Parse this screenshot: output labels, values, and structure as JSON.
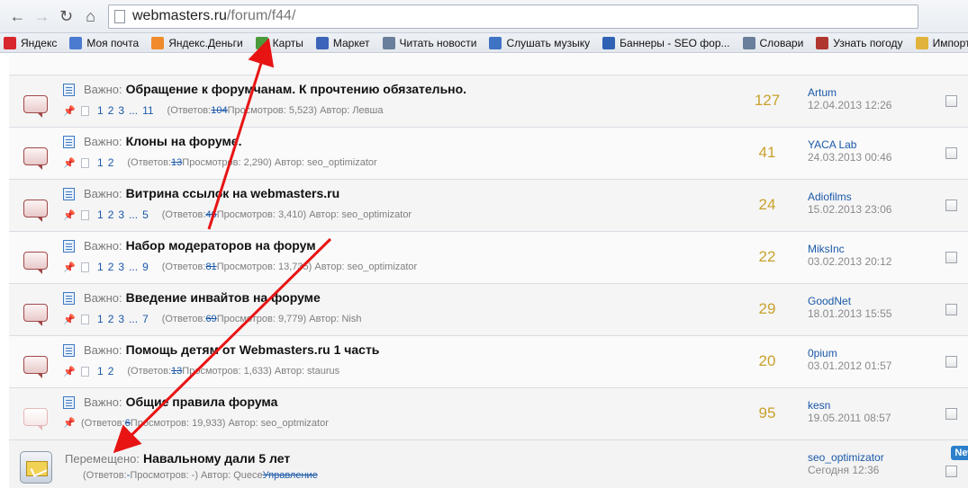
{
  "browser": {
    "url_host": "webmasters.ru",
    "url_path": "/forum/f44/"
  },
  "bookmarks": [
    {
      "label": "Яндекс",
      "icon": "yandex-icon",
      "color": "#d8272d"
    },
    {
      "label": "Моя почта",
      "icon": "mail-icon",
      "color": "#4a7bd0"
    },
    {
      "label": "Яндекс.Деньги",
      "icon": "money-icon",
      "color": "#f08b2b"
    },
    {
      "label": "Карты",
      "icon": "map-icon",
      "color": "#4a9a3c"
    },
    {
      "label": "Маркет",
      "icon": "market-icon",
      "color": "#3c64b8"
    },
    {
      "label": "Читать новости",
      "icon": "page-icon",
      "color": "#6a7f9b"
    },
    {
      "label": "Слушать музыку",
      "icon": "music-icon",
      "color": "#3f73c4"
    },
    {
      "label": "Баннеры - SEO фор...",
      "icon": "star-icon",
      "color": "#2f62b4"
    },
    {
      "label": "Словари",
      "icon": "page-icon",
      "color": "#6a7f9b"
    },
    {
      "label": "Узнать погоду",
      "icon": "weather-icon",
      "color": "#b0372f"
    },
    {
      "label": "Импорт",
      "icon": "folder-icon",
      "color": "#e0b43c"
    }
  ],
  "topics": [
    {
      "prefix": "Важно:",
      "title": "Обращение к форумчанам. К прочтению обязательно.",
      "pages": [
        "1",
        "2",
        "3",
        "...",
        "11"
      ],
      "meta_before": "(Ответов: ",
      "replies_struck": "104",
      "meta_after": " Просмотров: 5,523) Автор: Левша",
      "replies": "127",
      "last_user": "Artum",
      "last_time": "12.04.2013 12:26"
    },
    {
      "prefix": "Важно:",
      "title": "Клоны на форуме.",
      "pages": [
        "1",
        "2"
      ],
      "meta_before": "(Ответов: ",
      "replies_struck": "13",
      "meta_after": " Просмотров: 2,290) Автор: seo_optimizator",
      "replies": "41",
      "last_user": "YACA Lab",
      "last_time": "24.03.2013 00:46"
    },
    {
      "prefix": "Важно:",
      "title": "Витрина ссылок на webmasters.ru",
      "pages": [
        "1",
        "2",
        "3",
        "...",
        "5"
      ],
      "meta_before": "(Ответов: ",
      "replies_struck": "46",
      "meta_after": " Просмотров: 3,410) Автор: seo_optimizator",
      "replies": "24",
      "last_user": "Adiofilms",
      "last_time": "15.02.2013 23:06"
    },
    {
      "prefix": "Важно:",
      "title": "Набор модераторов на форум",
      "pages": [
        "1",
        "2",
        "3",
        "...",
        "9"
      ],
      "meta_before": "(Ответов: ",
      "replies_struck": "81",
      "meta_after": " Просмотров: 13,735) Автор: seo_optimizator",
      "replies": "22",
      "last_user": "MiksInc",
      "last_time": "03.02.2013 20:12"
    },
    {
      "prefix": "Важно:",
      "title": "Введение инвайтов на форуме",
      "pages": [
        "1",
        "2",
        "3",
        "...",
        "7"
      ],
      "meta_before": "(Ответов: ",
      "replies_struck": "69",
      "meta_after": " Просмотров: 9,779) Автор: Nish",
      "replies": "29",
      "last_user": "GoodNet",
      "last_time": "18.01.2013 15:55"
    },
    {
      "prefix": "Важно:",
      "title": "Помощь детям от Webmasters.ru 1 часть",
      "pages": [
        "1",
        "2"
      ],
      "meta_before": "(Ответов: ",
      "replies_struck": "13",
      "meta_after": " Просмотров: 1,633) Автор: staurus",
      "replies": "20",
      "last_user": "0pium",
      "last_time": "03.01.2012 01:57"
    },
    {
      "prefix": "Важно:",
      "title": "Общие правила форума",
      "pages": [],
      "meta_before": "(Ответов: ",
      "replies_struck": "6",
      "meta_after": " Просмотров: 19,933) Автор: seo_optmizator",
      "replies": "95",
      "last_user": "kesn",
      "last_time": "19.05.2011 08:57"
    }
  ],
  "moved_topic": {
    "prefix": "Перемещено:",
    "title": "Навальному дали 5 лет",
    "meta_before": "(Ответов: ",
    "replies_dash": "-",
    "meta_mid": " Просмотров: -) Автор: Quece",
    "meta_struck": "Управление",
    "last_user": "seo_optimizator",
    "last_time": "Сегодня 12:36",
    "badge": "New"
  },
  "colors": {
    "link": "#1a58a8",
    "replies": "#c8a12c",
    "arrow": "#e81414"
  }
}
